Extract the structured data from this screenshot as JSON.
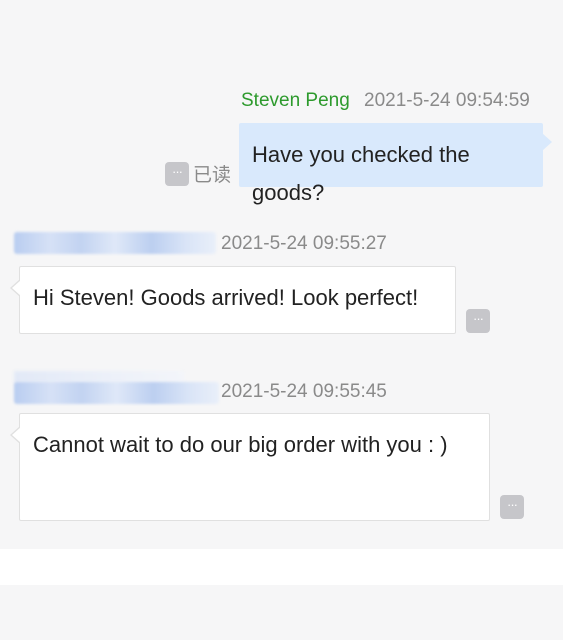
{
  "messages": [
    {
      "sender": "Steven Peng",
      "time": "2021-5-24 09:54:59",
      "text": "Have you checked the goods?",
      "read_status": "已读",
      "more_label": "···"
    },
    {
      "time": "2021-5-24 09:55:27",
      "text": "Hi Steven! Goods arrived! Look perfect!",
      "more_label": "···"
    },
    {
      "time": "2021-5-24 09:55:45",
      "text": "Cannot wait to do our big order with you : )",
      "more_label": "···"
    }
  ],
  "colors": {
    "sender_name": "#2d9a2d",
    "outgoing_bubble": "#d9e9fc",
    "incoming_bubble": "#ffffff",
    "timestamp": "#8a8a8a",
    "more_button": "#c6c6ca",
    "background": "#f6f6f7"
  },
  "icons": {
    "more": "ellipsis-icon",
    "redacted_name": "blurred-sender-name"
  }
}
